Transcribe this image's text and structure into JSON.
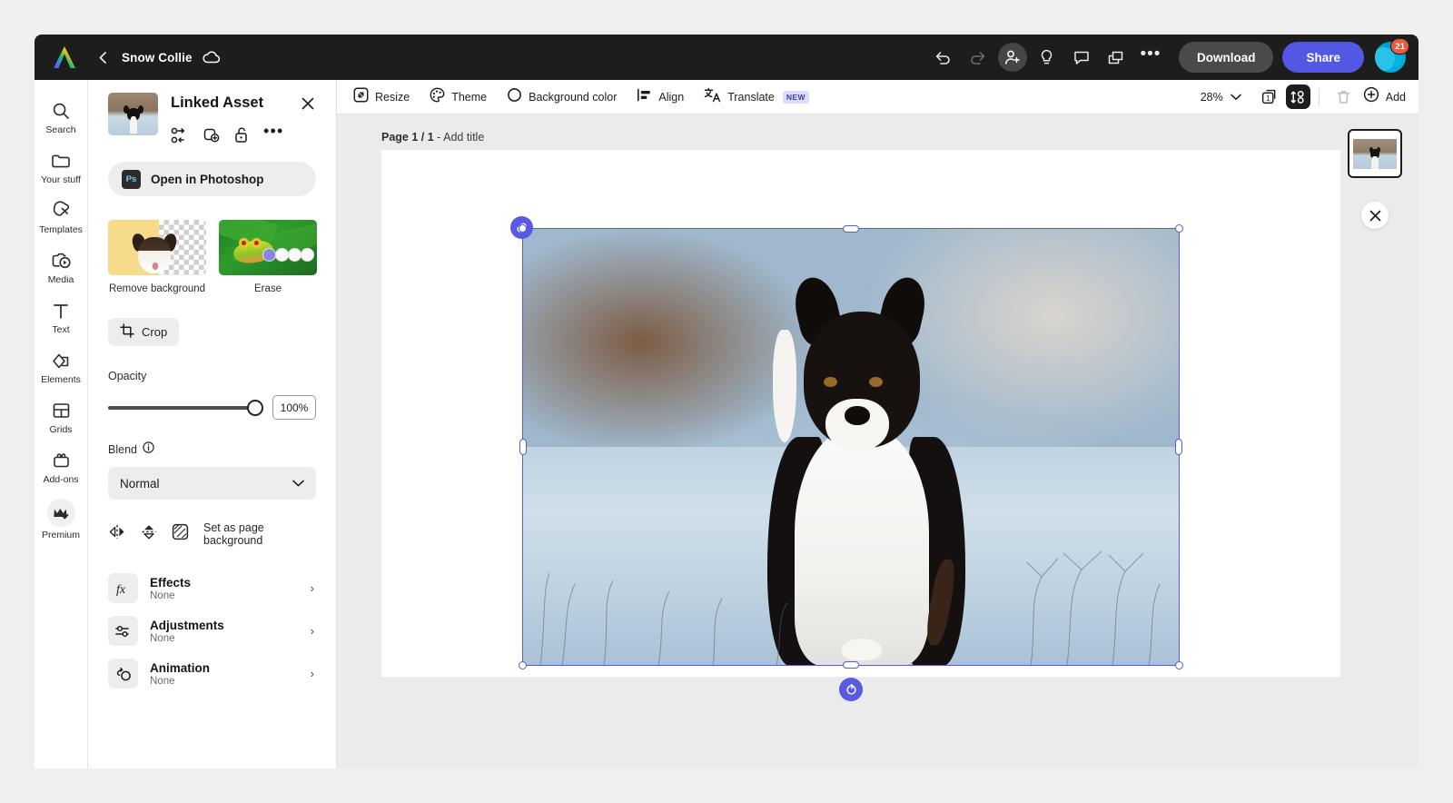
{
  "topbar": {
    "logo_name": "adobe-express-logo",
    "back_label": "‹",
    "doc_title": "Snow Collie",
    "cloud_status": "cloud-saved-icon",
    "icons": [
      {
        "name": "undo-icon",
        "label": "Undo"
      },
      {
        "name": "redo-icon",
        "label": "Redo"
      },
      {
        "name": "invite-user-icon",
        "label": "Invite"
      },
      {
        "name": "ideas-lightbulb-icon",
        "label": "Ideas"
      },
      {
        "name": "comment-icon",
        "label": "Comments"
      },
      {
        "name": "duplicate-pages-icon",
        "label": "Duplicate"
      }
    ],
    "more_label": "•••",
    "download_label": "Download",
    "share_label": "Share",
    "notification_count": "21",
    "accent_share": "#5258e4",
    "badge_color": "#ec5b3f"
  },
  "rail": {
    "items": [
      {
        "label": "Search",
        "icon": "search-icon"
      },
      {
        "label": "Your stuff",
        "icon": "folder-icon"
      },
      {
        "label": "Templates",
        "icon": "templates-icon"
      },
      {
        "label": "Media",
        "icon": "media-icon"
      },
      {
        "label": "Text",
        "icon": "text-icon"
      },
      {
        "label": "Elements",
        "icon": "elements-icon"
      },
      {
        "label": "Grids",
        "icon": "grids-icon"
      },
      {
        "label": "Add-ons",
        "icon": "addons-icon"
      },
      {
        "label": "Premium",
        "icon": "premium-crown-icon"
      }
    ]
  },
  "panel": {
    "title": "Linked Asset",
    "close_label": "✕",
    "thumbnail_name": "linked-asset-thumbnail",
    "actions": [
      {
        "name": "replace-asset-icon",
        "label": "Replace"
      },
      {
        "name": "duplicate-asset-icon",
        "label": "Duplicate"
      },
      {
        "name": "unlock-asset-icon",
        "label": "Unlock"
      },
      {
        "name": "more-options-icon",
        "label": "•••"
      }
    ],
    "photoshop_button": {
      "chip": "Ps",
      "label": "Open in Photoshop"
    },
    "cards": [
      {
        "label": "Remove background",
        "name": "remove-background-card"
      },
      {
        "label": "Erase",
        "name": "erase-card"
      }
    ],
    "crop_label": "Crop",
    "opacity": {
      "label": "Opacity",
      "value": "100%",
      "percent": 100
    },
    "blend": {
      "label": "Blend",
      "info": "ⓘ",
      "value": "Normal"
    },
    "flip": {
      "horizontal_name": "flip-horizontal-icon",
      "vertical_name": "flip-vertical-icon",
      "page_bg_label": "Set as page background"
    },
    "list": [
      {
        "title": "Effects",
        "subtitle": "None",
        "icon": "effects-fx-icon"
      },
      {
        "title": "Adjustments",
        "subtitle": "None",
        "icon": "adjustments-sliders-icon"
      },
      {
        "title": "Animation",
        "subtitle": "None",
        "icon": "animation-icon"
      }
    ],
    "chevron": "›"
  },
  "toolbar": {
    "tools": [
      {
        "label": "Resize",
        "icon": "resize-icon"
      },
      {
        "label": "Theme",
        "icon": "theme-palette-icon"
      },
      {
        "label": "Background color",
        "icon": "background-color-icon"
      },
      {
        "label": "Align",
        "icon": "align-icon"
      },
      {
        "label": "Translate",
        "icon": "translate-icon",
        "badge": "NEW"
      }
    ],
    "zoom_value": "28%",
    "zoom_chevron": "⌄",
    "right_icons": [
      {
        "name": "page-count-icon",
        "label": "1"
      },
      {
        "name": "arrange-objects-icon",
        "label": "Arrange",
        "active": true
      },
      {
        "name": "delete-trash-icon",
        "label": "Delete",
        "disabled": true
      }
    ],
    "add_label": "Add"
  },
  "canvas": {
    "page_label_bold": "Page 1 / 1",
    "page_label_rest": " - Add title",
    "selection": {
      "link_badge": "link-chain-icon",
      "rotate_badge": "rotate-handle-icon",
      "accent": "#5a5ae0"
    },
    "photo_alt": "border-collie-in-snow"
  },
  "pages_rail": {
    "thumb_name": "page-thumbnail-1",
    "close_label": "✕"
  }
}
